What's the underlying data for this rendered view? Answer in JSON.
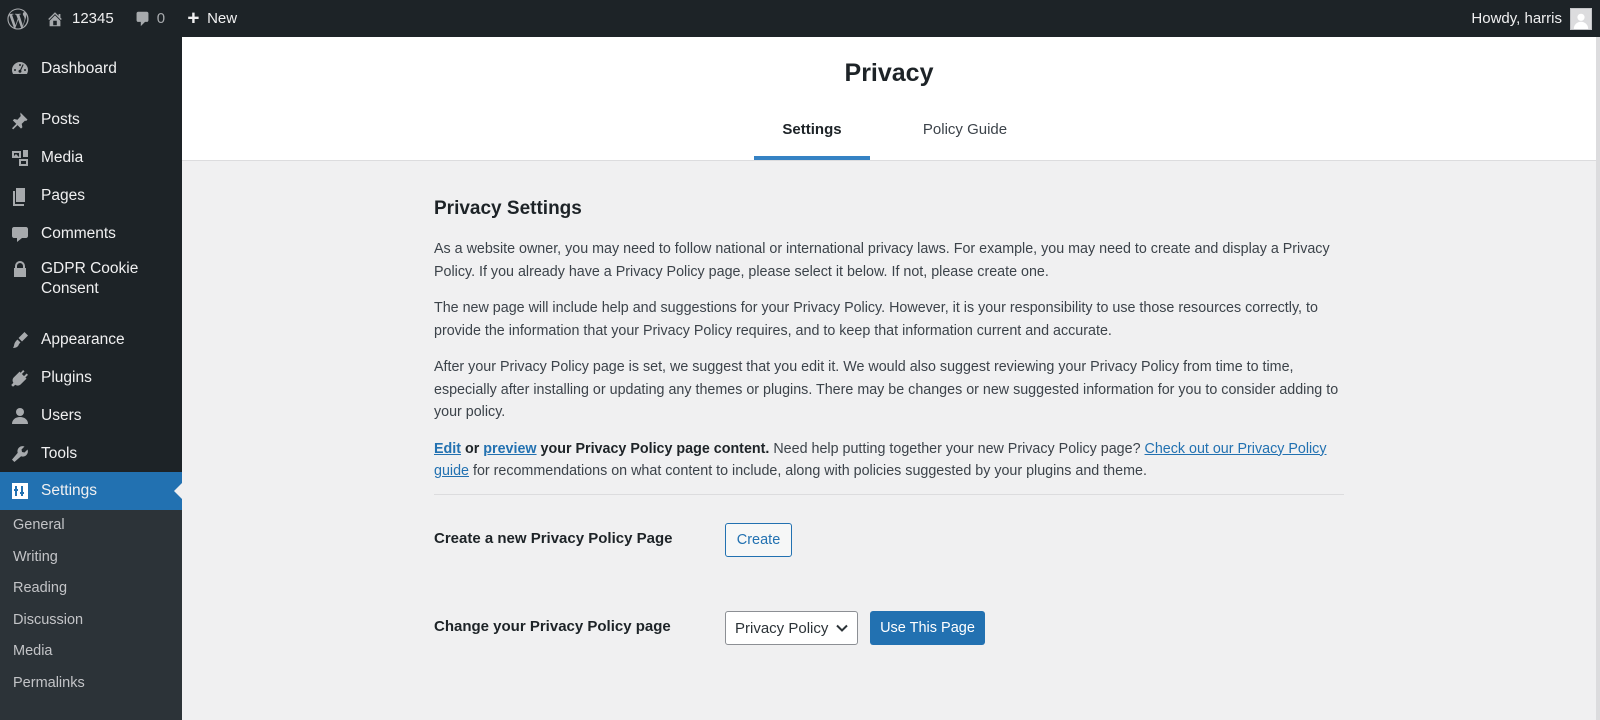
{
  "adminbar": {
    "site_name": "12345",
    "comments_count": "0",
    "new_label": "New",
    "howdy": "Howdy, harris"
  },
  "sidebar": {
    "items": [
      {
        "label": "Dashboard",
        "icon": "dashboard-icon"
      },
      {
        "label": "Posts",
        "icon": "pushpin-icon"
      },
      {
        "label": "Media",
        "icon": "media-icon"
      },
      {
        "label": "Pages",
        "icon": "pages-icon"
      },
      {
        "label": "Comments",
        "icon": "comment-icon"
      },
      {
        "label": "GDPR Cookie",
        "label2": "Consent",
        "icon": "lock-icon"
      },
      {
        "label": "Appearance",
        "icon": "brush-icon"
      },
      {
        "label": "Plugins",
        "icon": "plugin-icon"
      },
      {
        "label": "Users",
        "icon": "user-icon"
      },
      {
        "label": "Tools",
        "icon": "wrench-icon"
      },
      {
        "label": "Settings",
        "icon": "settings-icon",
        "active": true
      }
    ],
    "submenu": [
      "General",
      "Writing",
      "Reading",
      "Discussion",
      "Media",
      "Permalinks"
    ]
  },
  "header": {
    "title": "Privacy",
    "tabs": [
      {
        "label": "Settings",
        "active": true
      },
      {
        "label": "Policy Guide",
        "active": false
      }
    ]
  },
  "content": {
    "heading": "Privacy Settings",
    "p1": "As a website owner, you may need to follow national or international privacy laws. For example, you may need to create and display a Privacy Policy. If you already have a Privacy Policy page, please select it below. If not, please create one.",
    "p2": "The new page will include help and suggestions for your Privacy Policy. However, it is your responsibility to use those resources correctly, to provide the information that your Privacy Policy requires, and to keep that information current and accurate.",
    "p3": "After your Privacy Policy page is set, we suggest that you edit it. We would also suggest reviewing your Privacy Policy from time to time, especially after installing or updating any themes or plugins. There may be changes or new suggested information for you to consider adding to your policy.",
    "p4": {
      "edit_link": "Edit",
      "or": "or",
      "preview_link": "preview",
      "bold_rest": "your Privacy Policy page content.",
      "text": "Need help putting together your new Privacy Policy page?",
      "guide_link": "Check out our Privacy Policy guide",
      "tail": "for recommendations on what content to include, along with policies suggested by your plugins and theme."
    },
    "create_label": "Create a new Privacy Policy Page",
    "create_button": "Create",
    "change_label": "Change your Privacy Policy page",
    "select_value": "Privacy Policy",
    "use_button": "Use This Page"
  },
  "colors": {
    "accent": "#2271b1",
    "adminbar_bg": "#1d2327",
    "submenu_bg": "#2c3338",
    "content_bg": "#f0f0f1"
  }
}
